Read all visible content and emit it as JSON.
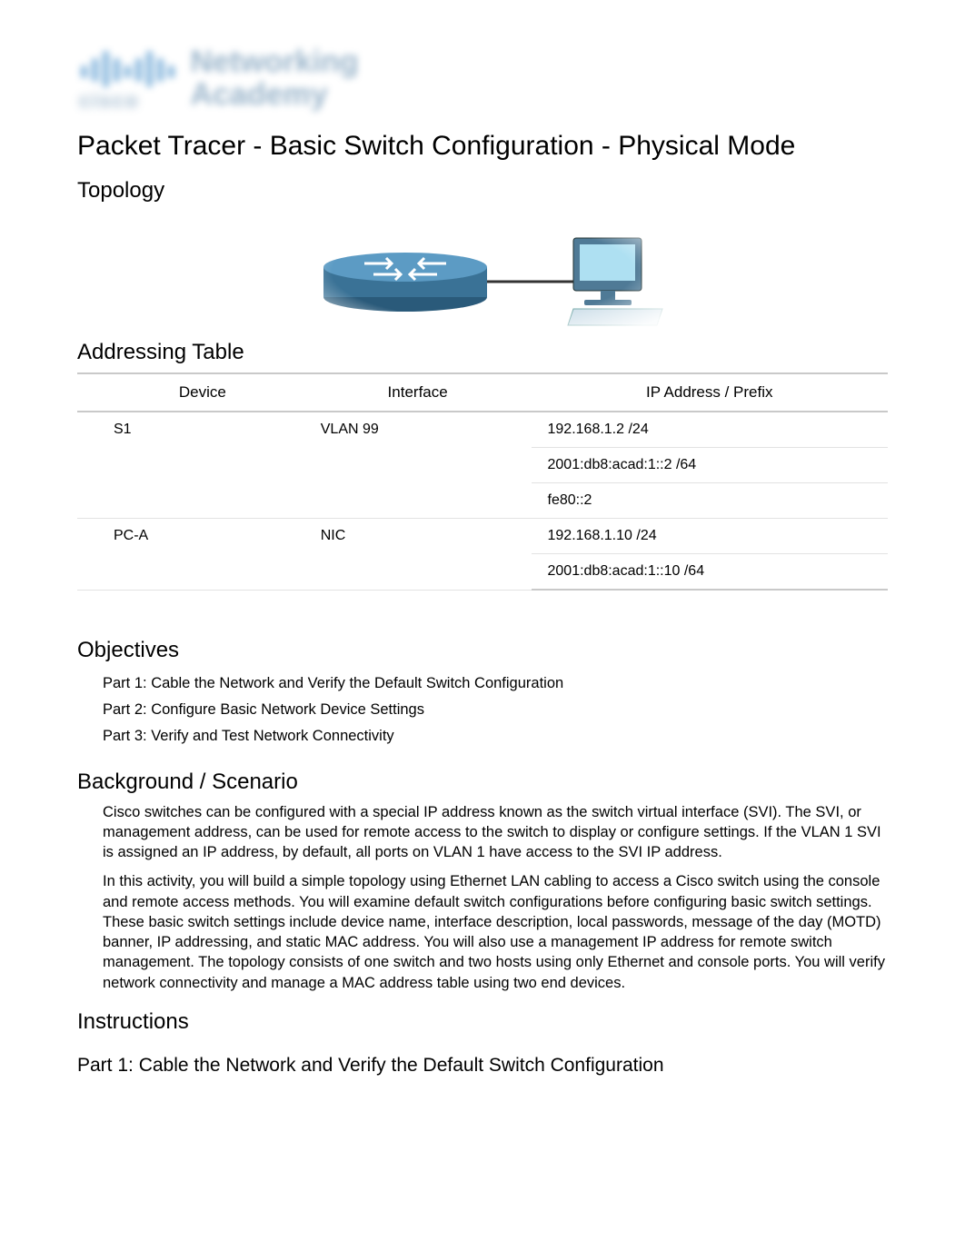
{
  "logo": {
    "brand_top": "Networking",
    "brand_bottom": "Academy",
    "company": "cisco"
  },
  "title": "Packet Tracer - Basic Switch Configuration - Physical Mode",
  "sections": {
    "topology": "Topology",
    "addressing_table": "Addressing Table",
    "objectives": "Objectives",
    "background": "Background / Scenario",
    "instructions": "Instructions",
    "part1": "Part 1: Cable the Network and Verify the Default Switch Configuration"
  },
  "addressing_table": {
    "headers": {
      "device": "Device",
      "interface": "Interface",
      "ip": "IP Address / Prefix"
    },
    "rows": [
      {
        "device": "S1",
        "interface": "VLAN 99",
        "ips": [
          "192.168.1.2 /24",
          "2001:db8:acad:1::2 /64",
          "fe80::2"
        ]
      },
      {
        "device": "PC-A",
        "interface": "NIC",
        "ips": [
          "192.168.1.10 /24",
          "2001:db8:acad:1::10 /64"
        ]
      }
    ]
  },
  "objectives": {
    "items": [
      "Part 1: Cable the Network and Verify the Default Switch Configuration",
      "Part 2: Configure Basic Network Device Settings",
      "Part 3: Verify and Test Network Connectivity"
    ]
  },
  "background": {
    "p1": "Cisco switches can be configured with a special IP address known as the switch virtual interface (SVI). The SVI, or management address, can be used for remote access to the switch to display or configure settings. If the VLAN 1 SVI is assigned an IP address, by default, all ports on VLAN 1 have access to the SVI IP address.",
    "p2": "In this activity, you will build a simple topology using Ethernet LAN cabling to access a Cisco switch using the console and remote access methods. You will examine default switch configurations before configuring basic switch settings. These basic switch settings include device name, interface description, local passwords, message of the day (MOTD) banner, IP addressing, and static MAC address. You will also use a management IP address for remote switch management. The topology consists of one switch and two hosts using only Ethernet and console ports. You will verify network connectivity and manage a MAC address table using two end devices."
  }
}
